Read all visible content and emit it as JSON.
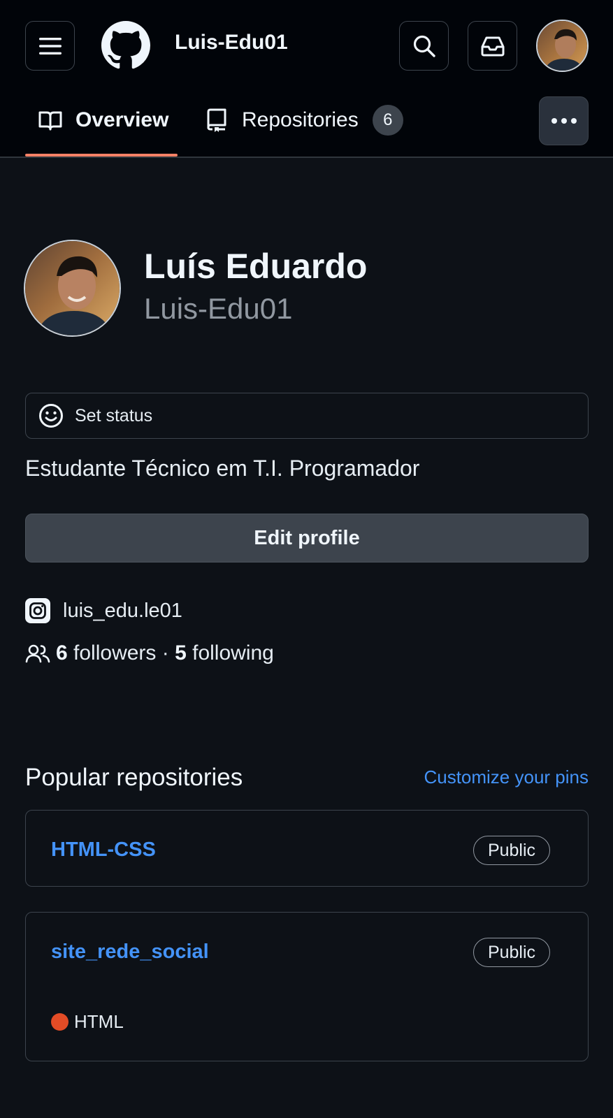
{
  "header": {
    "title": "Luis-Edu01"
  },
  "tabs": [
    {
      "label": "Overview",
      "active": true
    },
    {
      "label": "Repositories",
      "count": "6"
    }
  ],
  "profile": {
    "name": "Luís Eduardo",
    "login": "Luis-Edu01",
    "status_label": "Set status",
    "bio": "Estudante Técnico em T.I. Programador",
    "edit_label": "Edit profile",
    "instagram": "luis_edu.le01",
    "followers_count": "6",
    "followers_label": "followers",
    "separator": "·",
    "following_count": "5",
    "following_label": "following"
  },
  "popular": {
    "title": "Popular repositories",
    "customize_label": "Customize your pins",
    "repos": [
      {
        "name": "HTML-CSS",
        "visibility": "Public"
      },
      {
        "name": "site_rede_social",
        "visibility": "Public",
        "language": "HTML",
        "language_color": "#e34c26"
      }
    ]
  },
  "colors": {
    "background": "#0d1117",
    "link": "#4493f8",
    "tab_underline": "#f78166"
  }
}
